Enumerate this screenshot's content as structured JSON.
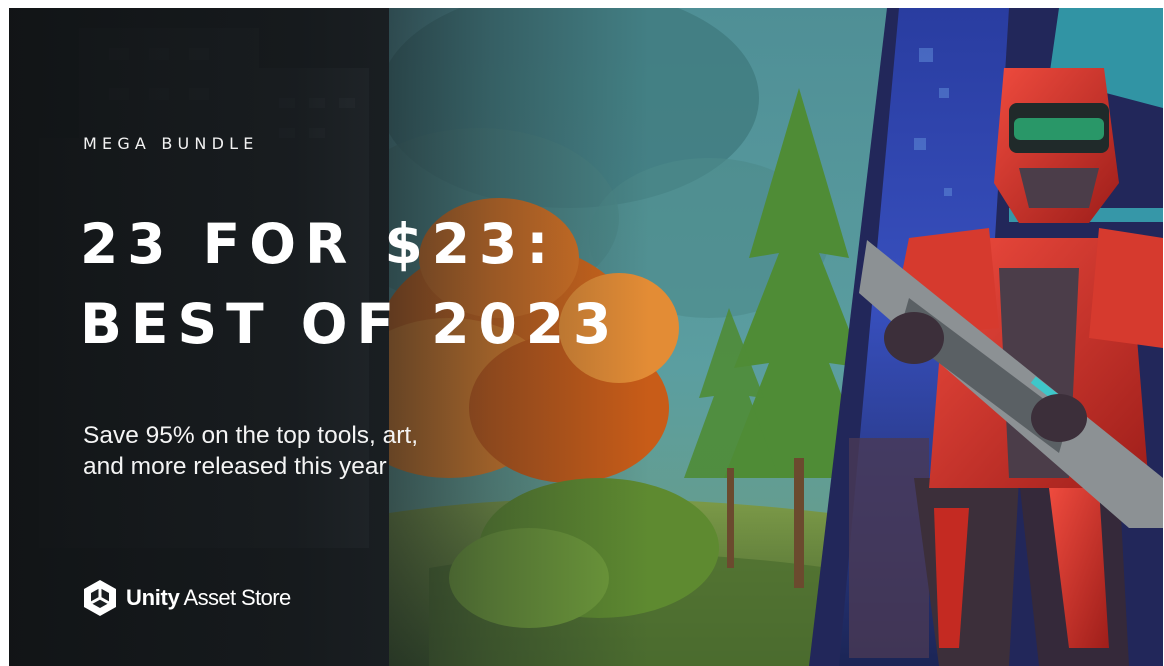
{
  "banner": {
    "eyebrow": "MEGA BUNDLE",
    "headline_line1": "23 FOR $23:",
    "headline_line2": "BEST OF 2023",
    "subtitle_line1": "Save 95% on the top tools, art,",
    "subtitle_line2": "and more released this year"
  },
  "brand": {
    "logo_icon": "unity-cube-icon",
    "name": "Unity",
    "product": "Asset Store"
  },
  "colors": {
    "text": "#ffffff",
    "accent_red": "#d8352c",
    "teal": "#3fc7c9",
    "orange_foliage": "#d9761f"
  }
}
